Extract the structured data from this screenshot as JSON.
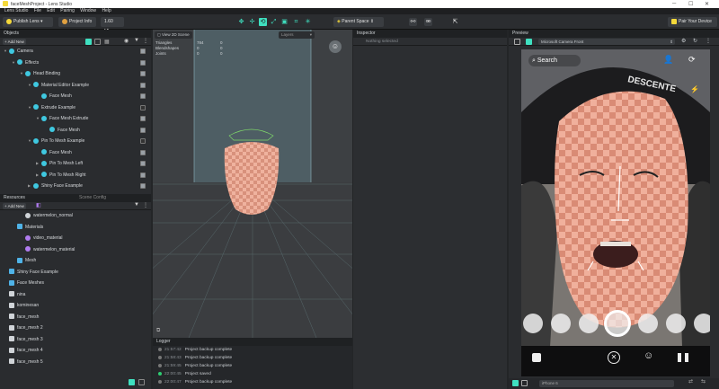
{
  "window": {
    "title": "faceMeshProject - Lens Studio"
  },
  "menu": [
    "Lens Studio",
    "File",
    "Edit",
    "Pairing",
    "Window",
    "Help"
  ],
  "toolbar": {
    "publish_label": "Publish Lens",
    "project_info_label": "Project Info",
    "size_label": "1.60 Mb",
    "space_label": "Parent Space",
    "pair_label": "Pair Your Device"
  },
  "objects_panel": {
    "title": "Objects",
    "add_label": "Add New",
    "items": [
      {
        "label": "Camera",
        "indent": 0,
        "expanded": true
      },
      {
        "label": "Effects",
        "indent": 1,
        "expanded": true
      },
      {
        "label": "Head Binding",
        "indent": 2,
        "expanded": true
      },
      {
        "label": "Material Editor Example",
        "indent": 3,
        "expanded": true
      },
      {
        "label": "Face Mesh",
        "indent": 4
      },
      {
        "label": "Extrude Example",
        "indent": 3,
        "expanded": true
      },
      {
        "label": "Face Mesh Extrude",
        "indent": 4,
        "expanded": true
      },
      {
        "label": "Face Mesh",
        "indent": 5
      },
      {
        "label": "Pin To Mesh Example",
        "indent": 3,
        "expanded": true
      },
      {
        "label": "Face Mesh",
        "indent": 4
      },
      {
        "label": "Pin To Mesh Left",
        "indent": 4,
        "expanded": false
      },
      {
        "label": "Pin To Mesh Right",
        "indent": 4,
        "expanded": false
      },
      {
        "label": "Shiny Face Example",
        "indent": 3,
        "expanded": false
      }
    ]
  },
  "resources_panel": {
    "title": "Resources",
    "tab2": "Scene Config",
    "add_label": "Add New",
    "items": [
      {
        "label": "watermelon_normal",
        "indent": 2
      },
      {
        "label": "Materials",
        "indent": 1,
        "folder": true
      },
      {
        "label": "video_material",
        "indent": 2
      },
      {
        "label": "watermelon_material",
        "indent": 2
      },
      {
        "label": "Mesh",
        "indent": 1,
        "folder": true
      },
      {
        "label": "Shiny Face Example",
        "indent": 0,
        "folder": true
      },
      {
        "label": "Face Meshes",
        "indent": 0,
        "folder": true
      },
      {
        "label": "nina",
        "indent": 0
      },
      {
        "label": "kominesan",
        "indent": 0
      },
      {
        "label": "face_mesh",
        "indent": 0
      },
      {
        "label": "face_mesh 2",
        "indent": 0
      },
      {
        "label": "face_mesh 3",
        "indent": 0
      },
      {
        "label": "face_mesh 4",
        "indent": 0
      },
      {
        "label": "face_mesh 5",
        "indent": 0
      }
    ]
  },
  "viewport": {
    "view_label": "View 2D Scene",
    "layers_label": "Layers",
    "stats": [
      {
        "name": "Triangles",
        "a": "784",
        "b": "0"
      },
      {
        "name": "Blendshapes",
        "a": "0",
        "b": "0"
      },
      {
        "name": "Joints",
        "a": "0",
        "b": "0"
      }
    ]
  },
  "logger": {
    "title": "Logger",
    "entries": [
      {
        "time": "21:57:42",
        "msg": "Project backup complete",
        "color": "#777777"
      },
      {
        "time": "21:58:43",
        "msg": "Project backup complete",
        "color": "#777777"
      },
      {
        "time": "21:59:45",
        "msg": "Project backup complete",
        "color": "#777777"
      },
      {
        "time": "22:00:45",
        "msg": "Project saved",
        "color": "#2ecc71"
      },
      {
        "time": "22:00:47",
        "msg": "Project backup complete",
        "color": "#777777"
      }
    ]
  },
  "inspector": {
    "title": "Inspector",
    "empty_label": "Nothing selected"
  },
  "preview": {
    "title": "Preview",
    "camera_label": "Microsoft Camera Front",
    "search_label": "Search",
    "device_label": "iPhone 6"
  },
  "colors": {
    "accent": "#3fe0c0",
    "pair_button": "#f5d93a",
    "face_mesh": "#e9a38d"
  }
}
